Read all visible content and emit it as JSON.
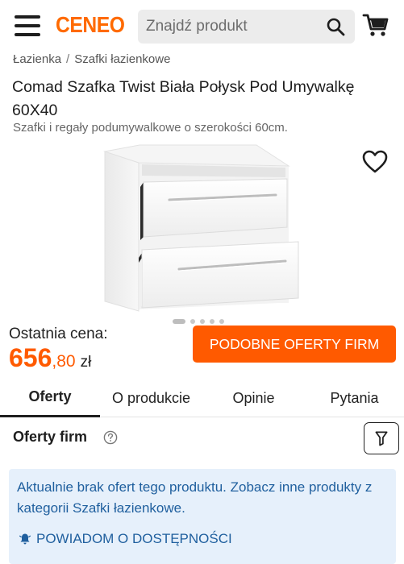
{
  "header": {
    "logo": "CENEO",
    "search_placeholder": "Znajdź produkt",
    "icons": [
      "menu-icon",
      "search-icon",
      "cart-icon"
    ]
  },
  "breadcrumb": {
    "items": [
      "Łazienka",
      "Szafki łazienkowe"
    ],
    "separator": "/"
  },
  "product": {
    "title": "Comad Szafka Twist Biała Połysk Pod Umywalkę 60X40",
    "subtitle": "Szafki i regały podumywalkowe o szerokości 60cm.",
    "image_alt": "white-bathroom-cabinet",
    "gallery_count": 5,
    "gallery_active_index": 0
  },
  "price": {
    "label": "Ostatnia cena:",
    "integer": "656",
    "fraction": ",80",
    "currency": "zł"
  },
  "actions": {
    "similar_offers": "PODOBNE OFERTY FIRM"
  },
  "tabs": [
    {
      "label": "Oferty",
      "active": true
    },
    {
      "label": "O produkcie",
      "active": false
    },
    {
      "label": "Opinie",
      "active": false
    },
    {
      "label": "Pytania",
      "active": false
    }
  ],
  "offers": {
    "heading": "Oferty firm",
    "info_text": "Aktualnie brak ofert tego produktu. Zobacz inne produkty z kategorii Szafki łazienkowe.",
    "notify_label": "POWIADOM O DOSTĘPNOŚCI"
  },
  "colors": {
    "brand": "#ff6a00",
    "accent_button": "#ff5a00",
    "price": "#ff5a00",
    "info_bg": "#e6f0fb",
    "info_text": "#1f5f9e"
  }
}
